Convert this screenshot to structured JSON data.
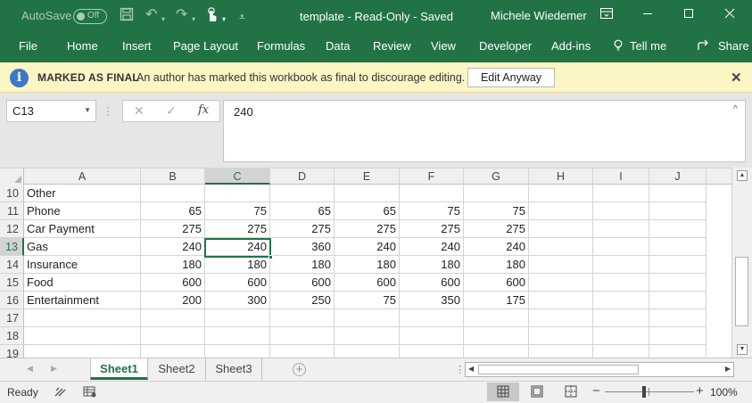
{
  "titlebar": {
    "autosave_label": "AutoSave",
    "autosave_state": "Off",
    "document_title": "template  -  Read-Only  -  Saved",
    "user_name": "Michele Wiedemer"
  },
  "ribbon": {
    "tabs": [
      "File",
      "Home",
      "Insert",
      "Page Layout",
      "Formulas",
      "Data",
      "Review",
      "View",
      "Developer",
      "Add-ins",
      "Tell me",
      "Share"
    ]
  },
  "message_bar": {
    "title": "MARKED AS FINAL",
    "text": "An author has marked this workbook as final to discourage editing.",
    "button": "Edit Anyway"
  },
  "formula_bar": {
    "name_box": "C13",
    "fx_label": "fx",
    "formula": "240"
  },
  "grid": {
    "columns": [
      "A",
      "B",
      "C",
      "D",
      "E",
      "F",
      "G",
      "H",
      "I",
      "J"
    ],
    "selected_column": "C",
    "selected_row": "13",
    "active_cell": "C13",
    "rows": [
      {
        "num": "10",
        "cells": [
          "Other",
          "",
          "",
          "",
          "",
          "",
          ""
        ]
      },
      {
        "num": "11",
        "cells": [
          "Phone",
          "65",
          "75",
          "65",
          "65",
          "75",
          "75"
        ]
      },
      {
        "num": "12",
        "cells": [
          "Car Payment",
          "275",
          "275",
          "275",
          "275",
          "275",
          "275"
        ]
      },
      {
        "num": "13",
        "cells": [
          "Gas",
          "240",
          "240",
          "360",
          "240",
          "240",
          "240"
        ]
      },
      {
        "num": "14",
        "cells": [
          "Insurance",
          "180",
          "180",
          "180",
          "180",
          "180",
          "180"
        ]
      },
      {
        "num": "15",
        "cells": [
          "Food",
          "600",
          "600",
          "600",
          "600",
          "600",
          "600"
        ]
      },
      {
        "num": "16",
        "cells": [
          "Entertainment",
          "200",
          "300",
          "250",
          "75",
          "350",
          "175"
        ]
      },
      {
        "num": "17",
        "cells": [
          "",
          "",
          "",
          "",
          "",
          "",
          ""
        ]
      },
      {
        "num": "18",
        "cells": [
          "",
          "",
          "",
          "",
          "",
          "",
          ""
        ]
      },
      {
        "num": "19",
        "cells": [
          "",
          "",
          "",
          "",
          "",
          "",
          ""
        ]
      }
    ]
  },
  "sheets": {
    "tabs": [
      "Sheet1",
      "Sheet2",
      "Sheet3"
    ],
    "active": "Sheet1"
  },
  "status": {
    "text": "Ready",
    "zoom": "100%"
  },
  "colors": {
    "brand_green": "#217346",
    "message_bar": "#fcf5c4",
    "info_blue": "#3a78c8"
  }
}
